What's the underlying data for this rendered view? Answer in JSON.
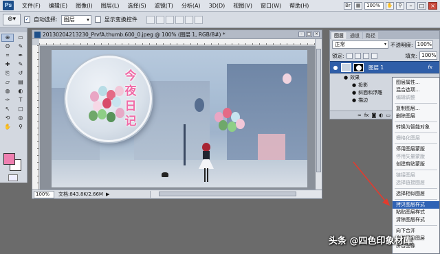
{
  "menubar": {
    "logo": "Ps",
    "items": [
      "文件(F)",
      "编辑(E)",
      "图像(I)",
      "图层(L)",
      "选择(S)",
      "滤镜(T)",
      "分析(A)",
      "3D(D)",
      "视图(V)",
      "窗口(W)",
      "帮助(H)"
    ],
    "zoom": "100%",
    "window_buttons": [
      "–",
      "□",
      "×"
    ]
  },
  "options": {
    "auto_select_label": "自动选择:",
    "auto_select_checked": "✓",
    "auto_select_value": "图层",
    "show_transform_label": "显示变换控件"
  },
  "tools": {
    "icons": [
      "move-icon",
      "marquee-icon",
      "lasso-icon",
      "quick-select-icon",
      "crop-icon",
      "eyedropper-icon",
      "healing-icon",
      "brush-icon",
      "stamp-icon",
      "history-brush-icon",
      "eraser-icon",
      "gradient-icon",
      "blur-icon",
      "dodge-icon",
      "pen-icon",
      "type-icon",
      "path-select-icon",
      "shape-icon",
      "3d-rotate-icon",
      "3d-orbit-icon",
      "hand-icon",
      "zoom-icon"
    ],
    "glyphs": [
      "⊕",
      "▭",
      "ʘ",
      "✎",
      "⌗",
      "✒",
      "✚",
      "✎",
      "⎘",
      "↺",
      "▱",
      "▤",
      "◍",
      "◐",
      "✑",
      "T",
      "↖",
      "▢",
      "⟲",
      "◎",
      "✋",
      "⚲"
    ],
    "foreground_color": "#ee7fb0",
    "background_color": "#ffffff"
  },
  "document": {
    "title": "20130204213230_PrvfA.thumb.600_0.jpeg @ 100% (图层 1, RGB/8#) *",
    "circle_title_chars": [
      "今",
      "夜",
      "日",
      "记"
    ],
    "status_zoom": "100%",
    "status_doc": "文档:843.8K/2.66M",
    "status_arrow": "▶"
  },
  "layers_panel": {
    "tabs": [
      "图层",
      "通道",
      "路径"
    ],
    "blend_mode": "正常",
    "opacity_label": "不透明度:",
    "opacity_value": "100%",
    "lock_label": "锁定:",
    "fill_label": "填充:",
    "fill_value": "100%",
    "layer_name": "图层 1",
    "fx": "fx",
    "effects_label": "效果",
    "effects": [
      "投影",
      "斜面和浮雕",
      "描边"
    ]
  },
  "context_menu": {
    "items": [
      {
        "label": "图层属性...",
        "enabled": true
      },
      {
        "label": "混合选项...",
        "enabled": true
      },
      {
        "label": "编辑调整",
        "enabled": false
      },
      {
        "sep": true
      },
      {
        "label": "复制图层...",
        "enabled": true
      },
      {
        "label": "删除图层",
        "enabled": true
      },
      {
        "sep": true
      },
      {
        "label": "转换为智能对象",
        "enabled": true
      },
      {
        "sep": true
      },
      {
        "label": "栅格化图层",
        "enabled": false
      },
      {
        "sep": true
      },
      {
        "label": "停用图层蒙版",
        "enabled": true
      },
      {
        "label": "停用矢量蒙版",
        "enabled": false
      },
      {
        "label": "创建剪贴蒙版",
        "enabled": true
      },
      {
        "sep": true
      },
      {
        "label": "链接图层",
        "enabled": false
      },
      {
        "label": "选择链接图层",
        "enabled": false
      },
      {
        "sep": true
      },
      {
        "label": "选择相似图层",
        "enabled": true
      },
      {
        "sep": true
      },
      {
        "label": "拷贝图层样式",
        "enabled": true,
        "highlight": true
      },
      {
        "label": "粘贴图层样式",
        "enabled": true
      },
      {
        "label": "清除图层样式",
        "enabled": true
      },
      {
        "sep": true
      },
      {
        "label": "向下合并",
        "enabled": true
      },
      {
        "label": "合并可见图层",
        "enabled": true
      },
      {
        "label": "拼合图像",
        "enabled": true
      }
    ]
  },
  "watermark": "头条 @四色印象材库",
  "colors": {
    "accent": "#2f63b5",
    "annotation_arrow": "#e23b2e",
    "title_pink": "#f06aa6"
  }
}
